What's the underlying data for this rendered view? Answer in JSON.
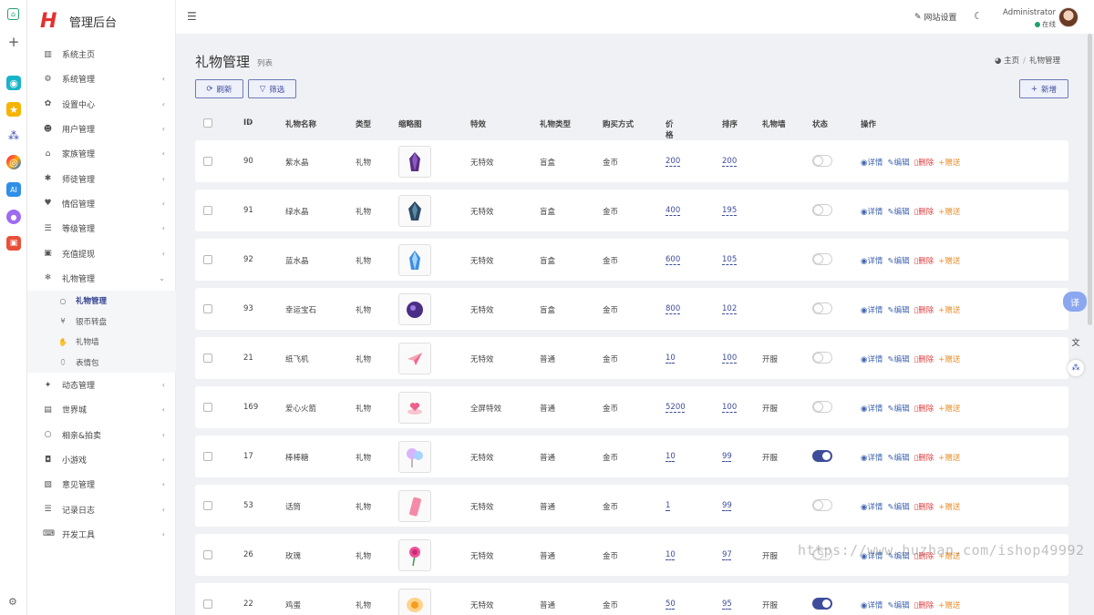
{
  "app": {
    "logo_letter": "H",
    "title": "管理后台"
  },
  "header": {
    "site_settings": "网站设置",
    "user_name": "Administrator",
    "user_status": "在线"
  },
  "sidebar": {
    "items": [
      {
        "label": "系统主页",
        "icon": "chart-icon"
      },
      {
        "label": "系统管理",
        "icon": "gear-icon"
      },
      {
        "label": "设置中心",
        "icon": "cog-icon"
      },
      {
        "label": "用户管理",
        "icon": "users-icon"
      },
      {
        "label": "家族管理",
        "icon": "building-icon"
      },
      {
        "label": "师徒管理",
        "icon": "asterisk-icon"
      },
      {
        "label": "情侣管理",
        "icon": "heart-icon"
      },
      {
        "label": "等级管理",
        "icon": "list-icon"
      },
      {
        "label": "充值提现",
        "icon": "money-icon"
      },
      {
        "label": "礼物管理",
        "icon": "snowflake-icon"
      }
    ],
    "sub_items": [
      {
        "label": "礼物管理",
        "icon": "circle-icon"
      },
      {
        "label": "银币转盘",
        "icon": "yen-icon"
      },
      {
        "label": "礼物墙",
        "icon": "hand-icon"
      },
      {
        "label": "表情包",
        "icon": "leaf-icon"
      }
    ],
    "items_after": [
      {
        "label": "动态管理",
        "icon": "twitter-icon"
      },
      {
        "label": "世界城",
        "icon": "map-icon"
      },
      {
        "label": "相亲&拍卖",
        "icon": "circle-icon"
      },
      {
        "label": "小游戏",
        "icon": "gamepad-icon"
      },
      {
        "label": "意见管理",
        "icon": "word-icon"
      },
      {
        "label": "记录日志",
        "icon": "list-icon"
      },
      {
        "label": "开发工具",
        "icon": "keyboard-icon"
      }
    ]
  },
  "page": {
    "title": "礼物管理",
    "subtitle": "列表",
    "breadcrumb_home": "主页",
    "breadcrumb_current": "礼物管理",
    "refresh_label": "刷新",
    "filter_label": "筛选",
    "add_label": "新增"
  },
  "table": {
    "columns": [
      "ID",
      "礼物名称",
      "类型",
      "缩略图",
      "特效",
      "礼物类型",
      "购买方式",
      "价格",
      "排序",
      "礼物墙",
      "状态",
      "操作"
    ],
    "ops": {
      "detail": "详情",
      "edit": "编辑",
      "delete": "删除",
      "gift": "赠送"
    },
    "rows": [
      {
        "id": "90",
        "name": "紫水晶",
        "type": "礼物",
        "effect": "无特效",
        "gift_type": "盲盒",
        "buy": "金币",
        "price": "200",
        "sort": "200",
        "wall": "",
        "status": false,
        "thumb": "purple-crystal"
      },
      {
        "id": "91",
        "name": "绿水晶",
        "type": "礼物",
        "effect": "无特效",
        "gift_type": "盲盒",
        "buy": "金币",
        "price": "400",
        "sort": "195",
        "wall": "",
        "status": false,
        "thumb": "green-crystal"
      },
      {
        "id": "92",
        "name": "蓝水晶",
        "type": "礼物",
        "effect": "无特效",
        "gift_type": "盲盒",
        "buy": "金币",
        "price": "600",
        "sort": "105",
        "wall": "",
        "status": false,
        "thumb": "blue-crystal"
      },
      {
        "id": "93",
        "name": "幸运宝石",
        "type": "礼物",
        "effect": "无特效",
        "gift_type": "盲盒",
        "buy": "金币",
        "price": "800",
        "sort": "102",
        "wall": "",
        "status": false,
        "thumb": "lucky-gem"
      },
      {
        "id": "21",
        "name": "纸飞机",
        "type": "礼物",
        "effect": "无特效",
        "gift_type": "普通",
        "buy": "金币",
        "price": "10",
        "sort": "100",
        "wall": "开服",
        "status": false,
        "thumb": "paper-plane"
      },
      {
        "id": "169",
        "name": "爱心火箭",
        "type": "礼物",
        "effect": "全屏特效",
        "gift_type": "普通",
        "buy": "金币",
        "price": "5200",
        "sort": "100",
        "wall": "开服",
        "status": false,
        "thumb": "heart-rocket"
      },
      {
        "id": "17",
        "name": "棒棒糖",
        "type": "礼物",
        "effect": "无特效",
        "gift_type": "普通",
        "buy": "金币",
        "price": "10",
        "sort": "99",
        "wall": "开服",
        "status": true,
        "thumb": "lollipop"
      },
      {
        "id": "53",
        "name": "话筒",
        "type": "礼物",
        "effect": "无特效",
        "gift_type": "普通",
        "buy": "金币",
        "price": "1",
        "sort": "99",
        "wall": "",
        "status": false,
        "thumb": "microphone"
      },
      {
        "id": "26",
        "name": "玫瑰",
        "type": "礼物",
        "effect": "无特效",
        "gift_type": "普通",
        "buy": "金币",
        "price": "10",
        "sort": "97",
        "wall": "开服",
        "status": false,
        "thumb": "rose"
      },
      {
        "id": "22",
        "name": "鸡蛋",
        "type": "礼物",
        "effect": "无特效",
        "gift_type": "普通",
        "buy": "金币",
        "price": "50",
        "sort": "95",
        "wall": "开服",
        "status": true,
        "thumb": "egg"
      }
    ]
  },
  "widgets": {
    "translate_label": "译"
  },
  "watermark": "https://www.huzhan.com/ishop49992",
  "colors": {
    "accent": "#3e4d9a",
    "danger": "#e04040",
    "warning": "#e8902c",
    "online": "#22a06b",
    "logo": "#e53030"
  }
}
